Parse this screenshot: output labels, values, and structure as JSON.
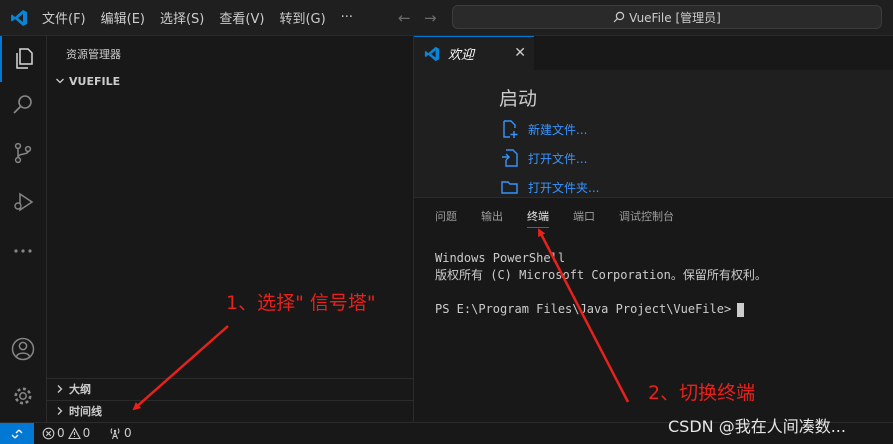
{
  "titlebar": {
    "menu": [
      "文件(F)",
      "编辑(E)",
      "选择(S)",
      "查看(V)",
      "转到(G)",
      "···"
    ],
    "search": "VueFile [管理员]"
  },
  "sidebar": {
    "title": "资源管理器",
    "folder": "VUEFILE",
    "outline": "大纲",
    "timeline": "时间线"
  },
  "editor": {
    "tab_label": "欢迎",
    "start_heading": "启动",
    "links": [
      "新建文件...",
      "打开文件...",
      "打开文件夹..."
    ]
  },
  "panel": {
    "tabs": [
      "问题",
      "输出",
      "终端",
      "端口",
      "调试控制台"
    ],
    "active_tab": "终端",
    "terminal_lines": [
      "Windows PowerShell",
      "版权所有 (C) Microsoft Corporation。保留所有权利。",
      "",
      "PS E:\\Program Files\\Java Project\\VueFile>"
    ]
  },
  "statusbar": {
    "errors": "0",
    "warnings": "0",
    "ports": "0"
  },
  "annotations": {
    "step1": "1、选择\" 信号塔\"",
    "step2": "2、切换终端",
    "color": "#e8211b"
  },
  "watermark": "CSDN @我在人间凑数...",
  "colors": {
    "accent": "#0078d4",
    "link": "#3794ff"
  }
}
